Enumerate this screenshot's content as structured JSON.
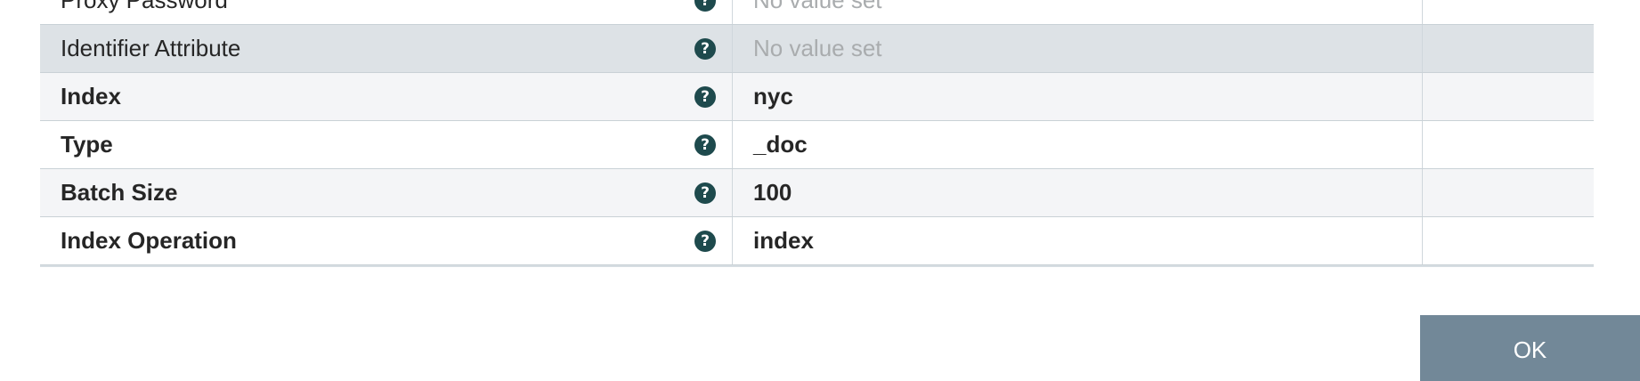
{
  "properties": [
    {
      "name": "Proxy Password",
      "value": "No value set",
      "required": false,
      "value_set": false,
      "help_icon": "question-circle-icon"
    },
    {
      "name": "Identifier Attribute",
      "value": "No value set",
      "required": false,
      "value_set": false,
      "help_icon": "question-circle-icon"
    },
    {
      "name": "Index",
      "value": "nyc",
      "required": true,
      "value_set": true,
      "help_icon": "question-circle-icon"
    },
    {
      "name": "Type",
      "value": "_doc",
      "required": true,
      "value_set": true,
      "help_icon": "question-circle-icon"
    },
    {
      "name": "Batch Size",
      "value": "100",
      "required": true,
      "value_set": true,
      "help_icon": "question-circle-icon"
    },
    {
      "name": "Index Operation",
      "value": "index",
      "required": true,
      "value_set": true,
      "help_icon": "question-circle-icon"
    }
  ],
  "help_glyph": "?",
  "footer": {
    "ok_label": "OK"
  },
  "colors": {
    "row_alt": "#f4f5f7",
    "row_selected": "#dde2e6",
    "help_icon": "#1e4a4d",
    "ok_button": "#728898",
    "placeholder_text": "#a9acae"
  }
}
